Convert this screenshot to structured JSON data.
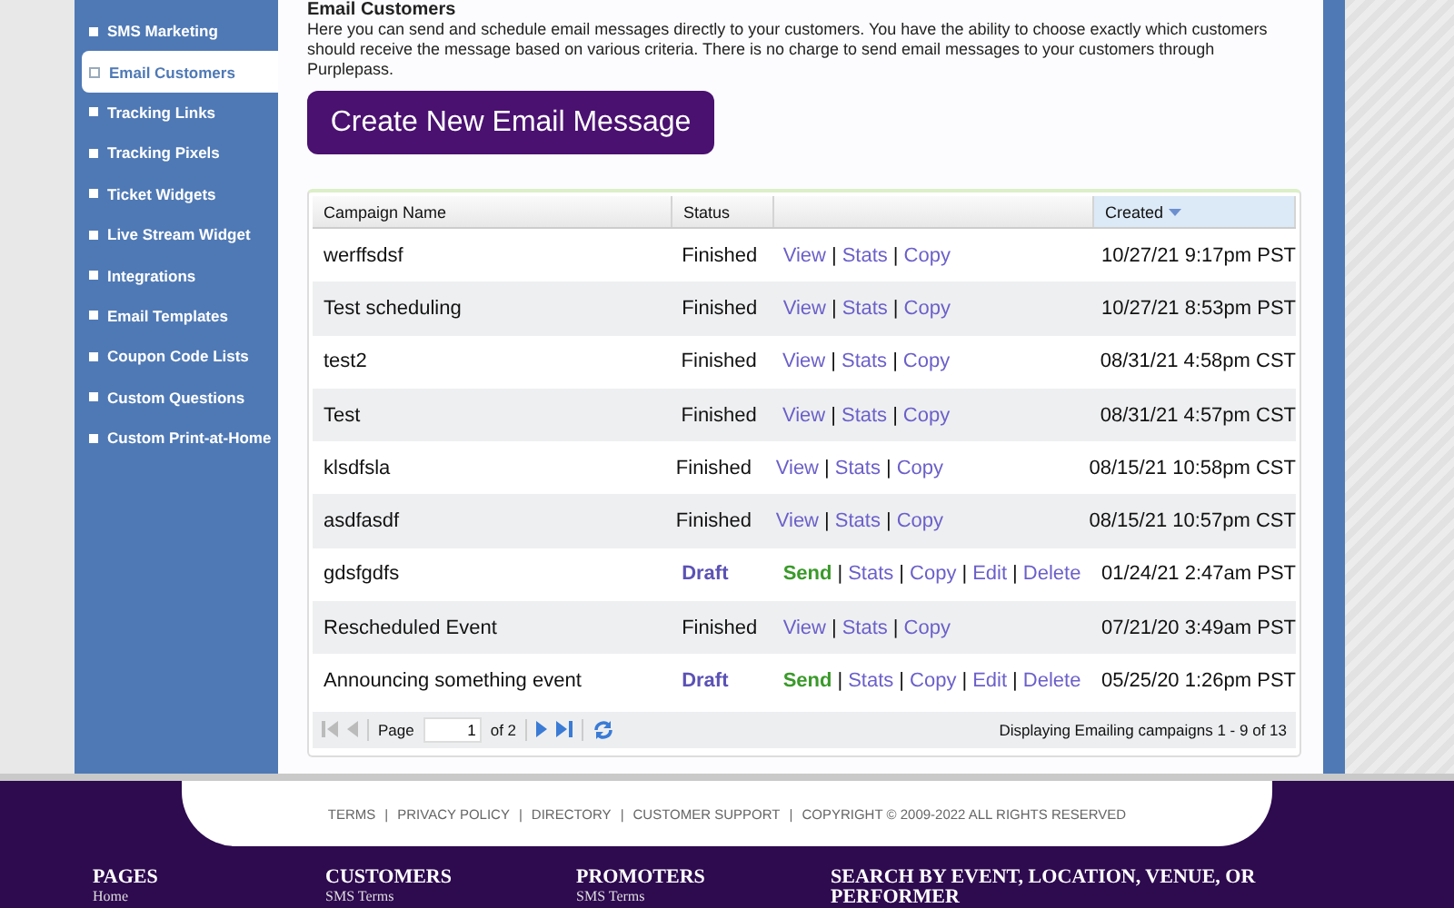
{
  "sidebar": {
    "items": [
      {
        "label": "SMS Marketing",
        "selected": false
      },
      {
        "label": "Email Customers",
        "selected": true
      },
      {
        "label": "Tracking Links",
        "selected": false
      },
      {
        "label": "Tracking Pixels",
        "selected": false
      },
      {
        "label": "Ticket Widgets",
        "selected": false
      },
      {
        "label": "Live Stream Widget",
        "selected": false
      },
      {
        "label": "Integrations",
        "selected": false
      },
      {
        "label": "Email Templates",
        "selected": false
      },
      {
        "label": "Coupon Code Lists",
        "selected": false
      },
      {
        "label": "Custom Questions",
        "selected": false
      },
      {
        "label": "Custom Print-at-Home",
        "selected": false
      }
    ]
  },
  "page": {
    "title": "Email Customers",
    "description": "Here you can send and schedule email messages directly to your customers. You have the ability to choose exactly which customers should receive the message based on various criteria. There is no charge to send email messages to your customers through Purplepass.",
    "create_button": "Create New Email Message"
  },
  "table": {
    "columns": [
      {
        "label": "Campaign Name",
        "sorted": false
      },
      {
        "label": "Status",
        "sorted": false
      },
      {
        "sorted": false
      },
      {
        "label": "Created",
        "sorted": true
      }
    ],
    "rows": [
      {
        "name": "werffsdsf",
        "status": "Finished",
        "kind": "finished",
        "actions": [
          {
            "label": "View",
            "kind": "link"
          },
          {
            "label": "Stats",
            "kind": "link"
          },
          {
            "label": "Copy",
            "kind": "link"
          }
        ],
        "created": "10/27/21 9:17pm PST"
      },
      {
        "name": "Test scheduling",
        "status": "Finished",
        "kind": "finished",
        "actions": [
          {
            "label": "View",
            "kind": "link"
          },
          {
            "label": "Stats",
            "kind": "link"
          },
          {
            "label": "Copy",
            "kind": "link"
          }
        ],
        "created": "10/27/21 8:53pm PST"
      },
      {
        "name": "test2",
        "status": "Finished",
        "kind": "finished",
        "actions": [
          {
            "label": "View",
            "kind": "link"
          },
          {
            "label": "Stats",
            "kind": "link"
          },
          {
            "label": "Copy",
            "kind": "link"
          }
        ],
        "created": "08/31/21 4:58pm CST"
      },
      {
        "name": "Test",
        "status": "Finished",
        "kind": "finished",
        "actions": [
          {
            "label": "View",
            "kind": "link"
          },
          {
            "label": "Stats",
            "kind": "link"
          },
          {
            "label": "Copy",
            "kind": "link"
          }
        ],
        "created": "08/31/21 4:57pm CST"
      },
      {
        "name": "klsdfsla",
        "status": "Finished",
        "kind": "finished",
        "actions": [
          {
            "label": "View",
            "kind": "link"
          },
          {
            "label": "Stats",
            "kind": "link"
          },
          {
            "label": "Copy",
            "kind": "link"
          }
        ],
        "created": "08/15/21 10:58pm CST"
      },
      {
        "name": "asdfasdf",
        "status": "Finished",
        "kind": "finished",
        "actions": [
          {
            "label": "View",
            "kind": "link"
          },
          {
            "label": "Stats",
            "kind": "link"
          },
          {
            "label": "Copy",
            "kind": "link"
          }
        ],
        "created": "08/15/21 10:57pm CST"
      },
      {
        "name": "gdsfgdfs",
        "status": "Draft",
        "kind": "draft",
        "actions": [
          {
            "label": "Send",
            "kind": "send"
          },
          {
            "label": "Stats",
            "kind": "link"
          },
          {
            "label": "Copy",
            "kind": "link"
          },
          {
            "label": "Edit",
            "kind": "link"
          },
          {
            "label": "Delete",
            "kind": "link"
          }
        ],
        "created": "01/24/21 2:47am PST"
      },
      {
        "name": "Rescheduled Event",
        "status": "Finished",
        "kind": "finished",
        "actions": [
          {
            "label": "View",
            "kind": "link"
          },
          {
            "label": "Stats",
            "kind": "link"
          },
          {
            "label": "Copy",
            "kind": "link"
          }
        ],
        "created": "07/21/20 3:49am PST"
      },
      {
        "name": "Announcing something event",
        "status": "Draft",
        "kind": "draft",
        "actions": [
          {
            "label": "Send",
            "kind": "send"
          },
          {
            "label": "Stats",
            "kind": "link"
          },
          {
            "label": "Copy",
            "kind": "link"
          },
          {
            "label": "Edit",
            "kind": "link"
          },
          {
            "label": "Delete",
            "kind": "link"
          }
        ],
        "created": "05/25/20 1:26pm PST"
      }
    ],
    "separator": "|",
    "pager": {
      "page_label": "Page",
      "page_value": "1",
      "of_label": "of 2",
      "summary": "Displaying Emailing campaigns 1 - 9 of 13"
    }
  },
  "footer": {
    "separator": "|",
    "links": [
      "TERMS",
      "PRIVACY POLICY",
      "DIRECTORY",
      "CUSTOMER SUPPORT",
      "COPYRIGHT © 2009-2022 ALL RIGHTS RESERVED"
    ],
    "columns": [
      {
        "heading": "PAGES",
        "link": "Home"
      },
      {
        "heading": "CUSTOMERS",
        "link": "SMS Terms"
      },
      {
        "heading": "PROMOTERS",
        "link": "SMS Terms"
      },
      {
        "heading": "SEARCH BY EVENT, LOCATION, VENUE, OR PERFORMER"
      }
    ]
  }
}
